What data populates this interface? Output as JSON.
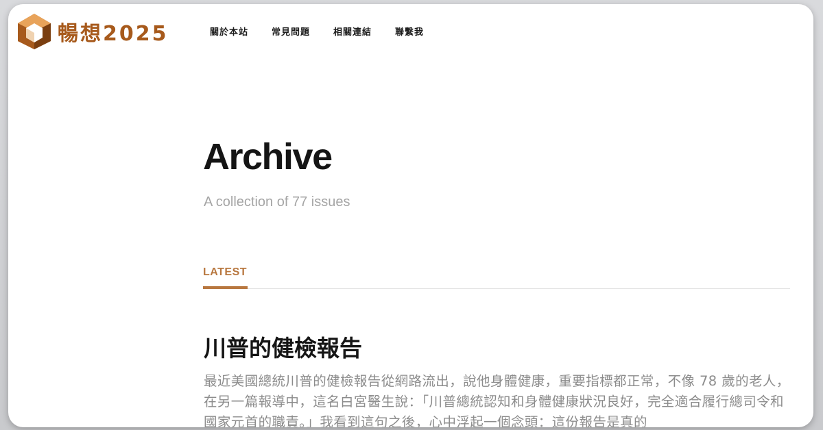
{
  "brand": {
    "logo_text": "暢想2025",
    "logo_colors": {
      "primary": "#a75a1c",
      "light": "#e8a35a",
      "dark": "#7a3e10"
    }
  },
  "nav": {
    "items": [
      {
        "label": "關於本站"
      },
      {
        "label": "常見問題"
      },
      {
        "label": "相關連結"
      },
      {
        "label": "聯繫我"
      }
    ]
  },
  "archive": {
    "title": "Archive",
    "subtitle": "A collection of 77 issues"
  },
  "tabs": {
    "active": "LATEST",
    "accent": "#b8773f"
  },
  "post": {
    "title": "川普的健檢報告",
    "excerpt": "最近美國總統川普的健檢報告從網路流出，說他身體健康，重要指標都正常，不像 78 歲的老人，在另一篇報導中，這名白宮醫生說：「川普總統認知和身體健康狀況良好，完全適合履行總司令和國家元首的職責。」我看到這句之後，心中浮起一個念頭：這份報告是真的"
  }
}
